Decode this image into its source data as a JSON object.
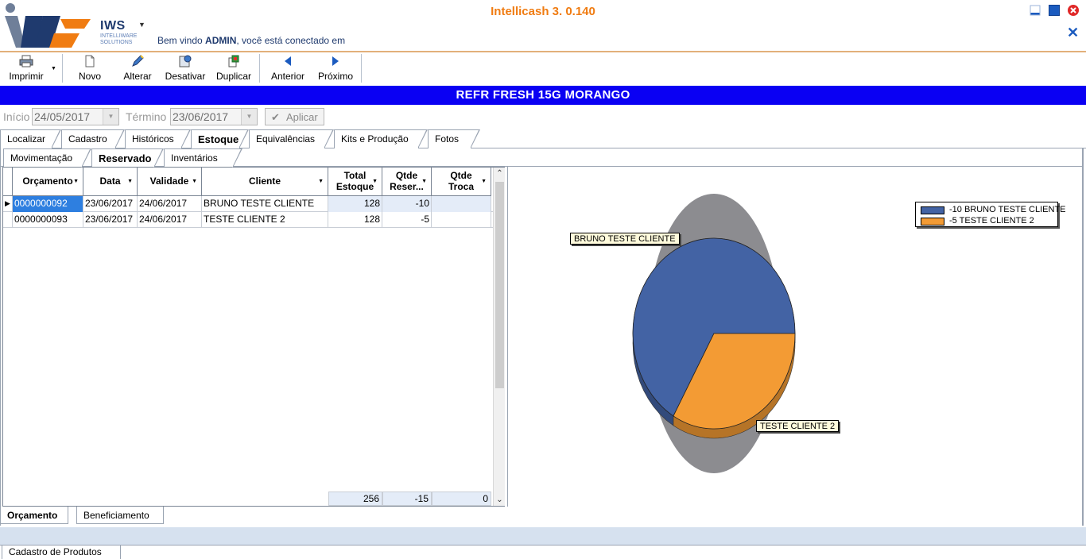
{
  "window": {
    "title": "Intellicash 3. 0.140",
    "welcome_prefix": "Bem vindo ",
    "welcome_user": "ADMIN",
    "welcome_suffix": ", você está conectado em",
    "logo_name": "IWS",
    "logo_sub1": "INTELLIWARE",
    "logo_sub2": "SOLUTIONS",
    "close_glyph": "✕"
  },
  "toolbar": {
    "imprimir": "Imprimir",
    "novo": "Novo",
    "alterar": "Alterar",
    "desativar": "Desativar",
    "duplicar": "Duplicar",
    "anterior": "Anterior",
    "proximo": "Próximo"
  },
  "product_title": "REFR FRESH 15G MORANGO",
  "filter": {
    "inicio_label": "Início",
    "inicio_value": "24/05/2017",
    "termino_label": "Término",
    "termino_value": "23/06/2017",
    "aplicar": "Aplicar"
  },
  "tabs_main": [
    "Localizar",
    "Cadastro",
    "Históricos",
    "Estoque",
    "Equivalências",
    "Kits e Produção",
    "Fotos"
  ],
  "tabs_main_active": "Estoque",
  "tabs_sub": [
    "Movimentação",
    "Reservado",
    "Inventários"
  ],
  "tabs_sub_active": "Reservado",
  "grid": {
    "headers": [
      "Orçamento",
      "Data",
      "Validade",
      "Cliente",
      "Total Estoque",
      "Qtde Reser...",
      "Qtde Troca"
    ],
    "header_lines": [
      [
        "Orçamento"
      ],
      [
        "Data"
      ],
      [
        "Validade"
      ],
      [
        "Cliente"
      ],
      [
        "Total",
        "Estoque"
      ],
      [
        "Qtde",
        "Reser..."
      ],
      [
        "Qtde",
        "Troca"
      ]
    ],
    "rows": [
      [
        "0000000092",
        "23/06/2017",
        "24/06/2017",
        "BRUNO TESTE CLIENTE",
        "128",
        "-10",
        ""
      ],
      [
        "0000000093",
        "23/06/2017",
        "24/06/2017",
        "TESTE CLIENTE 2",
        "128",
        "-5",
        ""
      ]
    ],
    "totals": [
      "256",
      "-15",
      "0"
    ]
  },
  "chart_data": {
    "type": "pie",
    "title": "",
    "categories": [
      "BRUNO TESTE CLIENTE",
      "TESTE CLIENTE 2"
    ],
    "values": [
      -10,
      -5
    ],
    "legend": [
      "-10 BRUNO TESTE CLIENTE",
      "-5 TESTE CLIENTE 2"
    ],
    "legend_position": "top-right",
    "colors": [
      "#4363a4",
      "#f39b34"
    ]
  },
  "tabs_bottom": [
    "Orçamento",
    "Beneficiamento"
  ],
  "tabs_bottom_active": "Orçamento",
  "taskbar": {
    "open_window": "Cadastro de Produtos"
  },
  "colors": {
    "accent_title": "#f07c12",
    "product_bar": "#0a00f3",
    "selection": "#2e7fe0"
  }
}
